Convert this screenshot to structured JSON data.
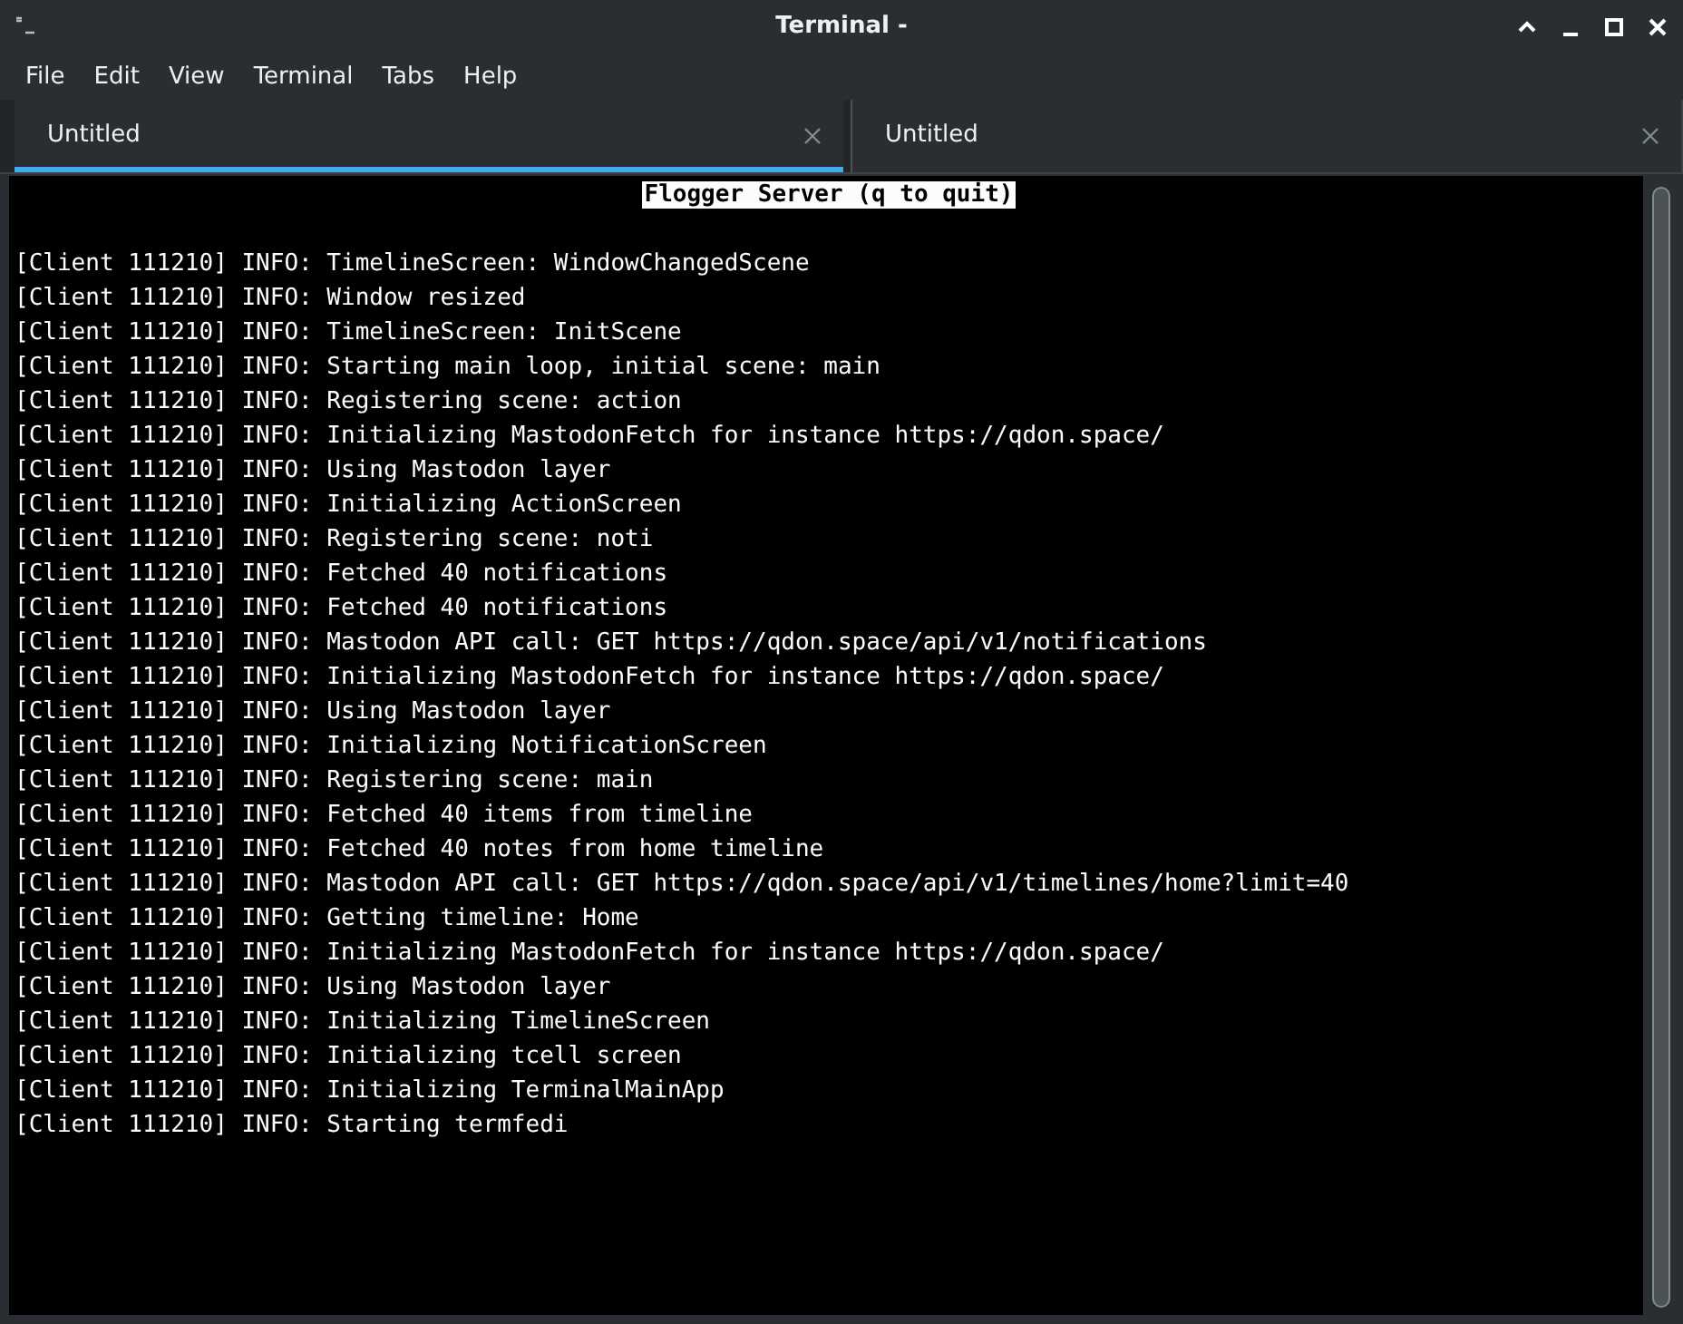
{
  "window": {
    "title": "Terminal -"
  },
  "menu": [
    "File",
    "Edit",
    "View",
    "Terminal",
    "Tabs",
    "Help"
  ],
  "tabs": [
    {
      "label": "Untitled",
      "selected": true
    },
    {
      "label": "Untitled",
      "selected": false
    }
  ],
  "terminal": {
    "header": "Flogger Server (q to quit)",
    "lines": [
      "[Client 111210] INFO: TimelineScreen: WindowChangedScene",
      "[Client 111210] INFO: Window resized",
      "[Client 111210] INFO: TimelineScreen: InitScene",
      "[Client 111210] INFO: Starting main loop, initial scene: main",
      "[Client 111210] INFO: Registering scene: action",
      "[Client 111210] INFO: Initializing MastodonFetch for instance https://qdon.space/",
      "[Client 111210] INFO: Using Mastodon layer",
      "[Client 111210] INFO: Initializing ActionScreen",
      "[Client 111210] INFO: Registering scene: noti",
      "[Client 111210] INFO: Fetched 40 notifications",
      "[Client 111210] INFO: Fetched 40 notifications",
      "[Client 111210] INFO: Mastodon API call: GET https://qdon.space/api/v1/notifications",
      "[Client 111210] INFO: Initializing MastodonFetch for instance https://qdon.space/",
      "[Client 111210] INFO: Using Mastodon layer",
      "[Client 111210] INFO: Initializing NotificationScreen",
      "[Client 111210] INFO: Registering scene: main",
      "[Client 111210] INFO: Fetched 40 items from timeline",
      "[Client 111210] INFO: Fetched 40 notes from home timeline",
      "[Client 111210] INFO: Mastodon API call: GET https://qdon.space/api/v1/timelines/home?limit=40",
      "[Client 111210] INFO: Getting timeline: Home",
      "[Client 111210] INFO: Initializing MastodonFetch for instance https://qdon.space/",
      "[Client 111210] INFO: Using Mastodon layer",
      "[Client 111210] INFO: Initializing TimelineScreen",
      "[Client 111210] INFO: Initializing tcell screen",
      "[Client 111210] INFO: Initializing TerminalMainApp",
      "[Client 111210] INFO: Starting termfedi"
    ]
  }
}
